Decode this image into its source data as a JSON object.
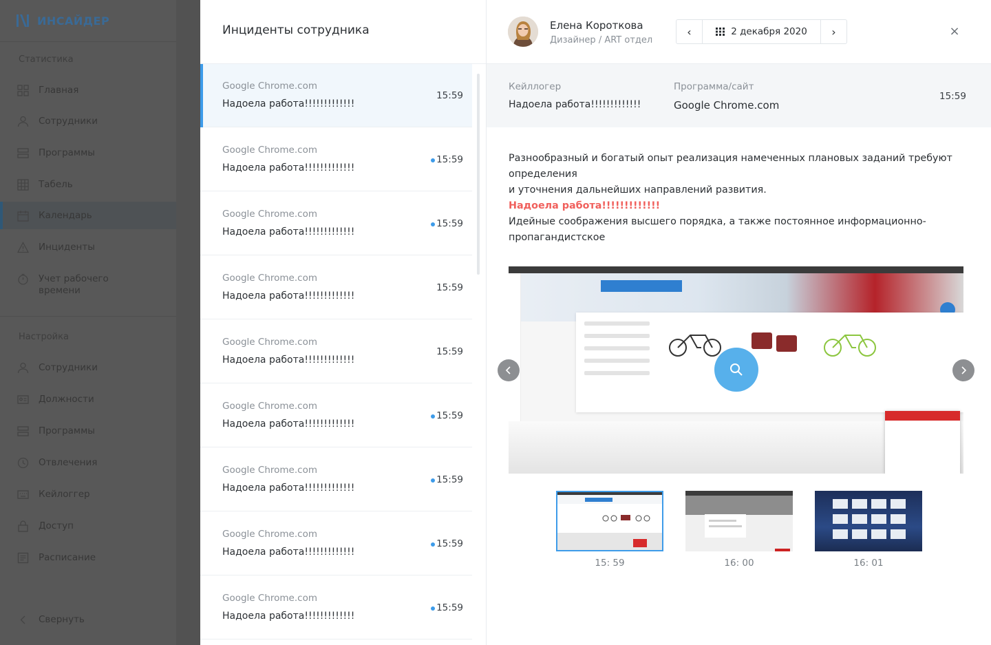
{
  "sidebar": {
    "logo_text": "ИНСАЙДЕР",
    "stats_title": "Статистика",
    "stats_items": [
      {
        "label": "Главная",
        "icon": "grid-icon"
      },
      {
        "label": "Сотрудники",
        "icon": "user-icon"
      },
      {
        "label": "Программы",
        "icon": "stack-icon"
      },
      {
        "label": "Табель",
        "icon": "table-icon"
      },
      {
        "label": "Календарь",
        "icon": "calendar-icon",
        "active": true
      },
      {
        "label": "Инциденты",
        "icon": "warning-icon"
      },
      {
        "label": "Учет рабочего времени",
        "icon": "timer-icon"
      }
    ],
    "settings_title": "Настройка",
    "settings_items": [
      {
        "label": "Сотрудники",
        "icon": "user-icon"
      },
      {
        "label": "Должности",
        "icon": "id-card-icon"
      },
      {
        "label": "Программы",
        "icon": "stack-icon"
      },
      {
        "label": "Отвлечения",
        "icon": "clock-icon"
      },
      {
        "label": "Кейлоггер",
        "icon": "keyboard-icon"
      },
      {
        "label": "Доступ",
        "icon": "lock-icon"
      },
      {
        "label": "Расписание",
        "icon": "schedule-icon"
      }
    ],
    "collapse_label": "Свернуть"
  },
  "incidents": {
    "title": "Инциденты сотрудника",
    "items": [
      {
        "source": "Google Chrome.com",
        "message": "Надоела работа!!!!!!!!!!!!!",
        "time": "15:59",
        "unread": false,
        "selected": true
      },
      {
        "source": "Google Chrome.com",
        "message": "Надоела работа!!!!!!!!!!!!!",
        "time": "15:59",
        "unread": true,
        "selected": false
      },
      {
        "source": "Google Chrome.com",
        "message": "Надоела работа!!!!!!!!!!!!!",
        "time": "15:59",
        "unread": true,
        "selected": false
      },
      {
        "source": "Google Chrome.com",
        "message": "Надоела работа!!!!!!!!!!!!!",
        "time": "15:59",
        "unread": false,
        "selected": false
      },
      {
        "source": "Google Chrome.com",
        "message": "Надоела работа!!!!!!!!!!!!!",
        "time": "15:59",
        "unread": false,
        "selected": false
      },
      {
        "source": "Google Chrome.com",
        "message": "Надоела работа!!!!!!!!!!!!!",
        "time": "15:59",
        "unread": true,
        "selected": false
      },
      {
        "source": "Google Chrome.com",
        "message": "Надоела работа!!!!!!!!!!!!!",
        "time": "15:59",
        "unread": true,
        "selected": false
      },
      {
        "source": "Google Chrome.com",
        "message": "Надоела работа!!!!!!!!!!!!!",
        "time": "15:59",
        "unread": true,
        "selected": false
      },
      {
        "source": "Google Chrome.com",
        "message": "Надоела работа!!!!!!!!!!!!!",
        "time": "15:59",
        "unread": true,
        "selected": false
      }
    ]
  },
  "detail": {
    "employee": {
      "name": "Елена Короткова",
      "role": "Дизайнер / ART отдел"
    },
    "date_nav": {
      "prev": "‹",
      "date": "2 декабря 2020",
      "next": "›"
    },
    "close": "×",
    "info": {
      "keylogger_label": "Кейллогер",
      "keylogger_value": "Надоела работа!!!!!!!!!!!!!",
      "program_label": "Программа/сайт",
      "program_value": "Google Chrome.com",
      "time": "15:59"
    },
    "text_lines": [
      "Разнообразный и богатый опыт реализация намеченных плановых заданий требуют определения",
      "и уточнения дальнейших направлений развития."
    ],
    "highlight": "Надоела работа!!!!!!!!!!!!!",
    "text_after": "Идейные соображения высшего порядка, а также постоянное информационно-пропагандистское",
    "thumbnails": [
      {
        "time": "15: 59",
        "selected": true
      },
      {
        "time": "16: 00",
        "selected": false
      },
      {
        "time": "16: 01",
        "selected": false
      }
    ]
  },
  "colors": {
    "accent": "#3d9be9",
    "highlight": "#f0605c",
    "overlay": "#585858"
  }
}
